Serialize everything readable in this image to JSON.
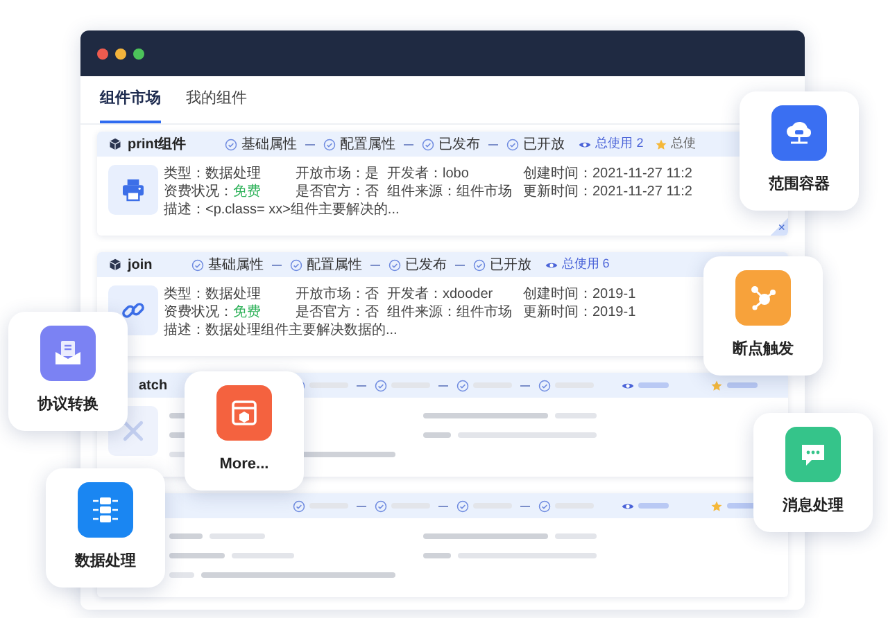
{
  "window": {
    "tabs": [
      {
        "label": "组件市场",
        "selected": true
      },
      {
        "label": "我的组件",
        "selected": false
      }
    ]
  },
  "components": [
    {
      "kind": "detail",
      "title": "print组件",
      "steps": [
        "基础属性",
        "配置属性",
        "已发布",
        "已开放"
      ],
      "usage": "总使用 2",
      "favorites": "总使",
      "close_mark": "×",
      "fields": [
        {
          "label": "类型：",
          "value": "数据处理",
          "highlight": false
        },
        {
          "label": "开放市场：",
          "value": "是",
          "highlight": false
        },
        {
          "label": "开发者：",
          "value": "lobo",
          "highlight": false
        },
        {
          "label": "创建时间：",
          "value": "2021-11-27 11:2",
          "highlight": false
        },
        {
          "label": "资费状况：",
          "value": "免费",
          "highlight": true
        },
        {
          "label": "是否官方：",
          "value": "否",
          "highlight": false
        },
        {
          "label": "组件来源：",
          "value": "组件市场",
          "highlight": false
        },
        {
          "label": "更新时间：",
          "value": "2021-11-27 11:2",
          "highlight": false
        }
      ],
      "description": "描述：<p.class= xx>组件主要解决的..."
    },
    {
      "kind": "detail",
      "title": "join",
      "steps": [
        "基础属性",
        "配置属性",
        "已发布",
        "已开放"
      ],
      "usage": "总使用 6",
      "fields": [
        {
          "label": "类型：",
          "value": "数据处理",
          "highlight": false
        },
        {
          "label": "开放市场：",
          "value": "否",
          "highlight": false
        },
        {
          "label": "开发者：",
          "value": "xdooder",
          "highlight": false
        },
        {
          "label": "创建时间：",
          "value": "2019-1",
          "highlight": false
        },
        {
          "label": "资费状况：",
          "value": "免费",
          "highlight": true
        },
        {
          "label": "是否官方：",
          "value": "否",
          "highlight": false
        },
        {
          "label": "组件来源：",
          "value": "组件市场",
          "highlight": false
        },
        {
          "label": "更新时间：",
          "value": "2019-1",
          "highlight": false
        }
      ],
      "description": "描述：数据处理组件主要解决数据的..."
    },
    {
      "kind": "skeleton",
      "title": "atch",
      "show_icon": true
    },
    {
      "kind": "skeleton",
      "show_icon": false
    }
  ],
  "floating_tiles": [
    {
      "label": "范围容器",
      "color": "#3a6ff2"
    },
    {
      "label": "断点触发",
      "color": "#f7a23b"
    },
    {
      "label": "消息处理",
      "color": "#35c48a"
    },
    {
      "label": "协议转换",
      "color": "#7b82f3"
    },
    {
      "label": "More...",
      "color": "#f4623f"
    },
    {
      "label": "数据处理",
      "color": "#1a86f2"
    }
  ]
}
